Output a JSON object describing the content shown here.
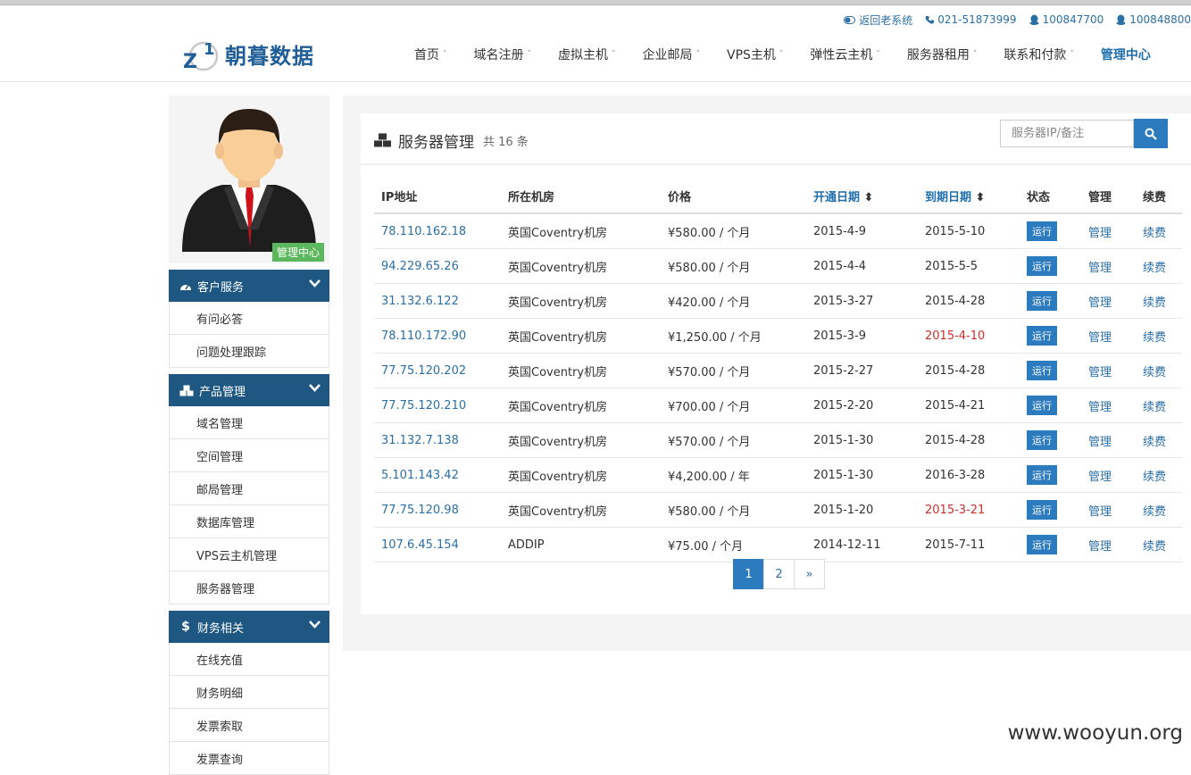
{
  "utility": {
    "old_system": "返回老系统",
    "phone": "021-51873999",
    "qq1": "100847700",
    "qq2": "100848800"
  },
  "brand": {
    "logo_mark": "Z1",
    "name": "朝暮数据"
  },
  "nav": [
    "首页",
    "域名注册",
    "虚拟主机",
    "企业邮局",
    "VPS主机",
    "弹性云主机",
    "服务器租用",
    "联系和付款"
  ],
  "nav_active": "管理中心",
  "sidebar": {
    "badge": "管理中心",
    "sections": [
      {
        "title": "客户服务",
        "icon": "dashboard-icon",
        "items": [
          "有问必答",
          "问题处理跟踪"
        ]
      },
      {
        "title": "产品管理",
        "icon": "cubes-icon",
        "items": [
          "域名管理",
          "空间管理",
          "邮局管理",
          "数据库管理",
          "VPS云主机管理",
          "服务器管理"
        ]
      },
      {
        "title": "财务相关",
        "icon": "dollar-icon",
        "items": [
          "在线充值",
          "财务明细",
          "发票索取",
          "发票查询"
        ]
      }
    ]
  },
  "panel": {
    "title": "服务器管理",
    "count": "共 16 条",
    "search_placeholder": "服务器IP/备注"
  },
  "table": {
    "headers": [
      "IP地址",
      "所在机房",
      "价格",
      "开通日期",
      "到期日期",
      "状态",
      "管理",
      "续费"
    ],
    "rows": [
      {
        "ip": "78.110.162.18",
        "room": "英国Coventry机房",
        "price": "¥580.00 / 个月",
        "open": "2015-4-9",
        "expire": "2015-5-10",
        "expired": false
      },
      {
        "ip": "94.229.65.26",
        "room": "英国Coventry机房",
        "price": "¥580.00 / 个月",
        "open": "2015-4-4",
        "expire": "2015-5-5",
        "expired": false
      },
      {
        "ip": "31.132.6.122",
        "room": "英国Coventry机房",
        "price": "¥420.00 / 个月",
        "open": "2015-3-27",
        "expire": "2015-4-28",
        "expired": false
      },
      {
        "ip": "78.110.172.90",
        "room": "英国Coventry机房",
        "price": "¥1,250.00 / 个月",
        "open": "2015-3-9",
        "expire": "2015-4-10",
        "expired": true
      },
      {
        "ip": "77.75.120.202",
        "room": "英国Coventry机房",
        "price": "¥570.00 / 个月",
        "open": "2015-2-27",
        "expire": "2015-4-28",
        "expired": false
      },
      {
        "ip": "77.75.120.210",
        "room": "英国Coventry机房",
        "price": "¥700.00 / 个月",
        "open": "2015-2-20",
        "expire": "2015-4-21",
        "expired": false
      },
      {
        "ip": "31.132.7.138",
        "room": "英国Coventry机房",
        "price": "¥570.00 / 个月",
        "open": "2015-1-30",
        "expire": "2015-4-28",
        "expired": false
      },
      {
        "ip": "5.101.143.42",
        "room": "英国Coventry机房",
        "price": "¥4,200.00 / 年",
        "open": "2015-1-30",
        "expire": "2016-3-28",
        "expired": false
      },
      {
        "ip": "77.75.120.98",
        "room": "英国Coventry机房",
        "price": "¥580.00 / 个月",
        "open": "2015-1-20",
        "expire": "2015-3-21",
        "expired": true
      },
      {
        "ip": "107.6.45.154",
        "room": "ADDIP",
        "price": "¥75.00 / 个月",
        "open": "2014-12-11",
        "expire": "2015-7-11",
        "expired": false
      }
    ],
    "status_label": "运行",
    "manage_label": "管理",
    "renew_label": "续费"
  },
  "pagination": [
    "1",
    "2",
    "»"
  ],
  "watermark": "www.wooyun.org",
  "colors": {
    "accent": "#2c7bbf",
    "sidebar_head": "#1d5782",
    "expired": "#c9302c",
    "badge": "#5cb85c"
  }
}
